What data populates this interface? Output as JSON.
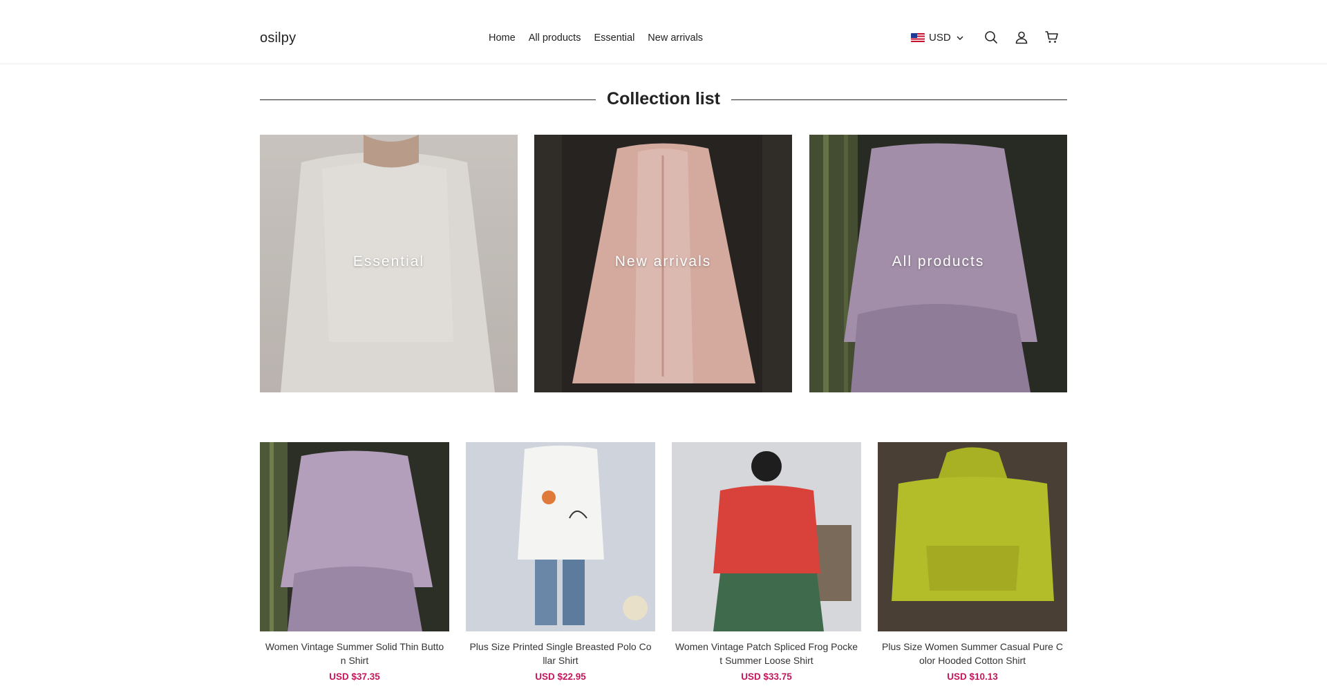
{
  "header": {
    "logo": "osilpy",
    "nav": [
      "Home",
      "All products",
      "Essential",
      "New arrivals"
    ],
    "currency": "USD"
  },
  "collections": {
    "title": "Collection list",
    "items": [
      {
        "label": "Essential"
      },
      {
        "label": "New arrivals"
      },
      {
        "label": "All products"
      }
    ]
  },
  "products": [
    {
      "name": "Women Vintage Summer Solid Thin Button Shirt",
      "price": "USD $37.35"
    },
    {
      "name": "Plus Size Printed Single Breasted Polo Collar Shirt",
      "price": "USD $22.95"
    },
    {
      "name": "Women Vintage Patch Spliced Frog Pocket Summer Loose Shirt",
      "price": "USD $33.75"
    },
    {
      "name": "Plus Size Women Summer Casual Pure Color Hooded Cotton Shirt",
      "price": "USD $10.13"
    }
  ],
  "colors": {
    "price": "#c2185b",
    "text": "#222222",
    "divider": "#ececec"
  },
  "icons": [
    "us-flag-icon",
    "chevron-down-icon",
    "search-icon",
    "account-icon",
    "cart-icon"
  ]
}
